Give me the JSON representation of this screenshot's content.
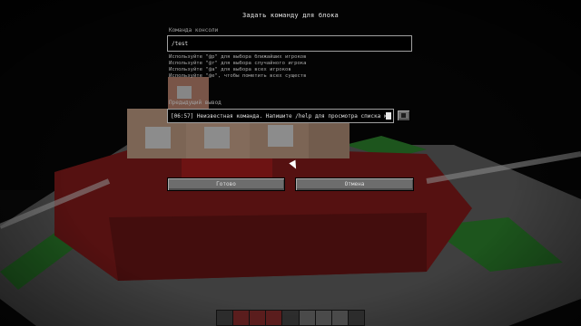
{
  "dialog": {
    "title": "Задать команду для блока",
    "console_label": "Команда консоли",
    "command_value": "/test",
    "hints": [
      "Используйте \"@p\" для выбора ближайших игроков",
      "Используйте \"@r\" для выбора случайного игрока",
      "Используйте \"@a\" для выбора всех игроков",
      "Используйте \"@e\", чтобы пометить всех существ"
    ],
    "previous_output_label": "Предыдущий вывод",
    "previous_output_value": "[06:57] Неизвестная команда. Напишите /help для просмотра списка ком",
    "done_label": "Готово",
    "cancel_label": "Отмена"
  },
  "colors": {
    "command_block": "#c9a48a",
    "redstone_block": "#9a1f1f",
    "white_concrete": "#cfcfcf",
    "green_concrete": "#2f8a2f",
    "button": "#6d6d6d"
  },
  "hotbar": {
    "slots": [
      "empty",
      "red",
      "red",
      "red",
      "empty",
      "white",
      "white",
      "white",
      "empty"
    ]
  }
}
